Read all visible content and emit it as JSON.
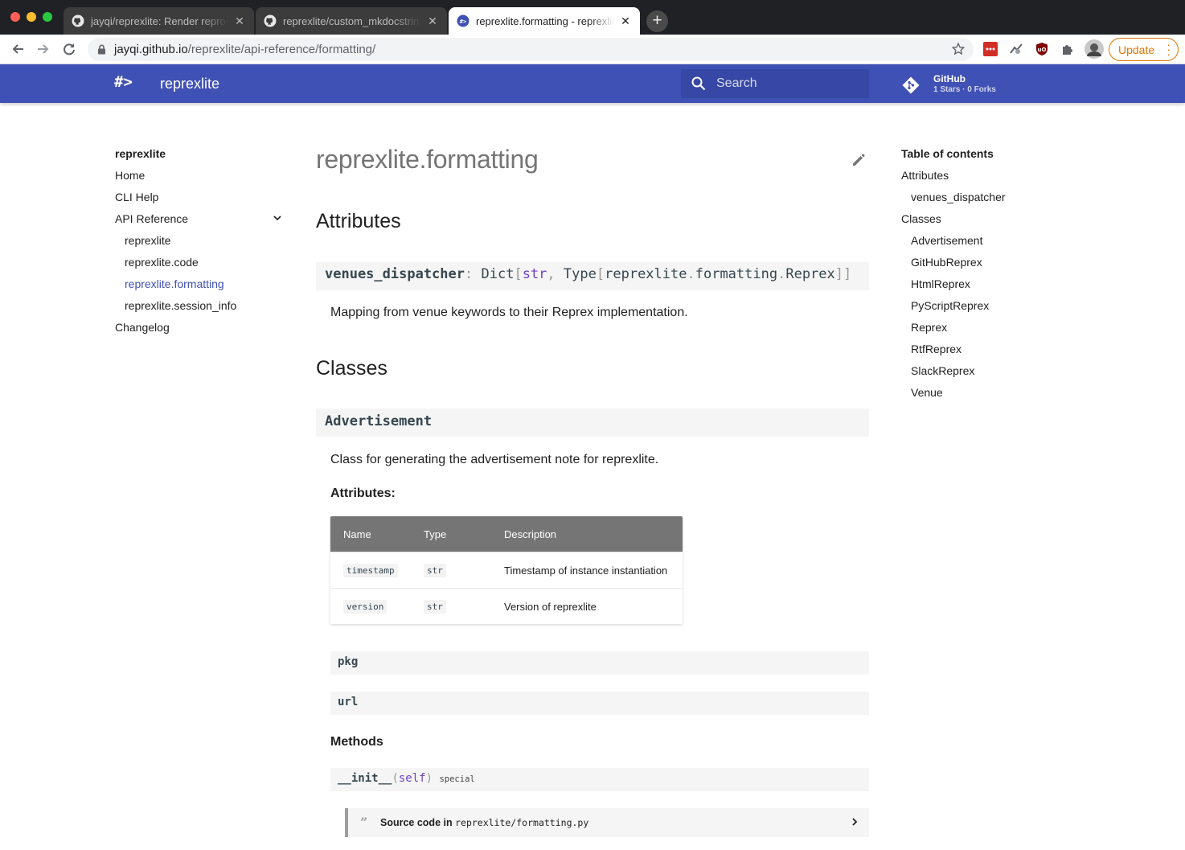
{
  "browser": {
    "tabs": [
      {
        "title": "jayqi/reprexlite: Render reproducible examples",
        "icon": "github-icon",
        "close": "✕"
      },
      {
        "title": "reprexlite/custom_mkdocstrings",
        "icon": "github-icon",
        "close": "✕"
      },
      {
        "title": "reprexlite.formatting - reprexlite",
        "icon": "reprexlite-icon",
        "close": "✕"
      }
    ],
    "url_host": "jayqi.github.io",
    "url_path": "/reprexlite/api-reference/formatting/",
    "update_label": "Update",
    "update_color": "#e37400"
  },
  "header": {
    "logo": "#>",
    "site_name": "reprexlite",
    "search_placeholder": "Search",
    "repo_name": "GitHub",
    "repo_facts": "1 Stars · 0 Forks",
    "color": "#4051b5"
  },
  "nav": {
    "title": "reprexlite",
    "items": [
      {
        "label": "Home"
      },
      {
        "label": "CLI Help"
      },
      {
        "label": "API Reference"
      },
      {
        "label": "reprexlite"
      },
      {
        "label": "reprexlite.code"
      },
      {
        "label": "reprexlite.formatting"
      },
      {
        "label": "reprexlite.session_info"
      },
      {
        "label": "Changelog"
      }
    ]
  },
  "content": {
    "title": "reprexlite.formatting",
    "attributes_heading": "Attributes",
    "venues_sig": {
      "name": "venues_dispatcher",
      "colon": ":",
      "t1": "Dict",
      "b1": "[",
      "k1": "str",
      "comma": ",",
      "t2": "Type",
      "b2": "[",
      "t3": "reprexlite",
      "dot1": ".",
      "t4": "formatting",
      "dot2": ".",
      "t5": "Reprex",
      "b3": "]]"
    },
    "venues_desc": "Mapping from venue keywords to their Reprex implementation.",
    "classes_heading": "Classes",
    "class_name": "Advertisement",
    "class_desc": "Class for generating the advertisement note for reprexlite.",
    "attributes_label": "Attributes:",
    "table": {
      "headers": [
        "Name",
        "Type",
        "Description"
      ],
      "rows": [
        {
          "name": "timestamp",
          "type": "str",
          "desc": "Timestamp of instance instantiation"
        },
        {
          "name": "version",
          "type": "str",
          "desc": "Version of reprexlite"
        }
      ]
    },
    "members": [
      "pkg",
      "url"
    ],
    "methods_label": "Methods",
    "init_sig": {
      "name": "__init__",
      "open": "(",
      "arg": "self",
      "close": ")",
      "label": "special"
    },
    "source_label": "Source code in",
    "source_file": "reprexlite/formatting.py"
  },
  "toc": {
    "title": "Table of contents",
    "items": [
      {
        "label": "Attributes"
      },
      {
        "label": "venues_dispatcher"
      },
      {
        "label": "Classes"
      },
      {
        "label": "Advertisement"
      },
      {
        "label": "GitHubReprex"
      },
      {
        "label": "HtmlReprex"
      },
      {
        "label": "PyScriptReprex"
      },
      {
        "label": "Reprex"
      },
      {
        "label": "RtfReprex"
      },
      {
        "label": "SlackReprex"
      },
      {
        "label": "Venue"
      }
    ]
  }
}
